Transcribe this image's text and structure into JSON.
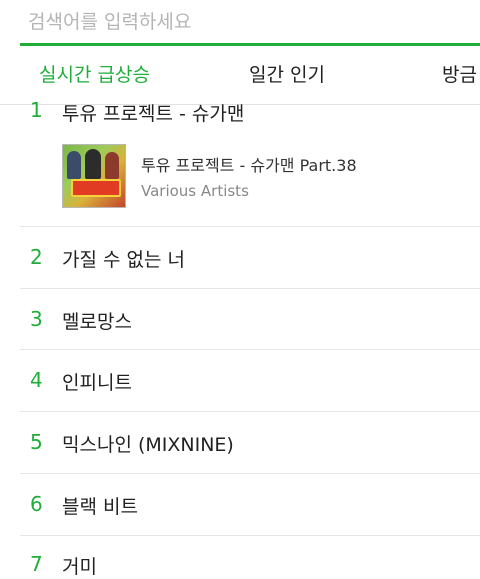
{
  "search": {
    "placeholder": "검색어를 입력하세요",
    "value": ""
  },
  "tabs": [
    {
      "label": "실시간 급상승",
      "active": true
    },
    {
      "label": "일간 인기",
      "active": false
    },
    {
      "label": "방금",
      "active": false
    }
  ],
  "chart": [
    {
      "rank": "1",
      "title": "투유 프로젝트 - 슈가맨",
      "album": {
        "title": "투유 프로젝트 - 슈가맨 Part.38",
        "artist": "Various Artists"
      }
    },
    {
      "rank": "2",
      "title": "가질 수 없는 너"
    },
    {
      "rank": "3",
      "title": "멜로망스"
    },
    {
      "rank": "4",
      "title": "인피니트"
    },
    {
      "rank": "5",
      "title": "믹스나인 (MIXNINE)"
    },
    {
      "rank": "6",
      "title": "블랙 비트"
    },
    {
      "rank": "7",
      "title": "거미"
    }
  ],
  "colors": {
    "accent": "#1fae3a",
    "divider": "#e6e6e6",
    "placeholder": "#b5b5b5"
  }
}
